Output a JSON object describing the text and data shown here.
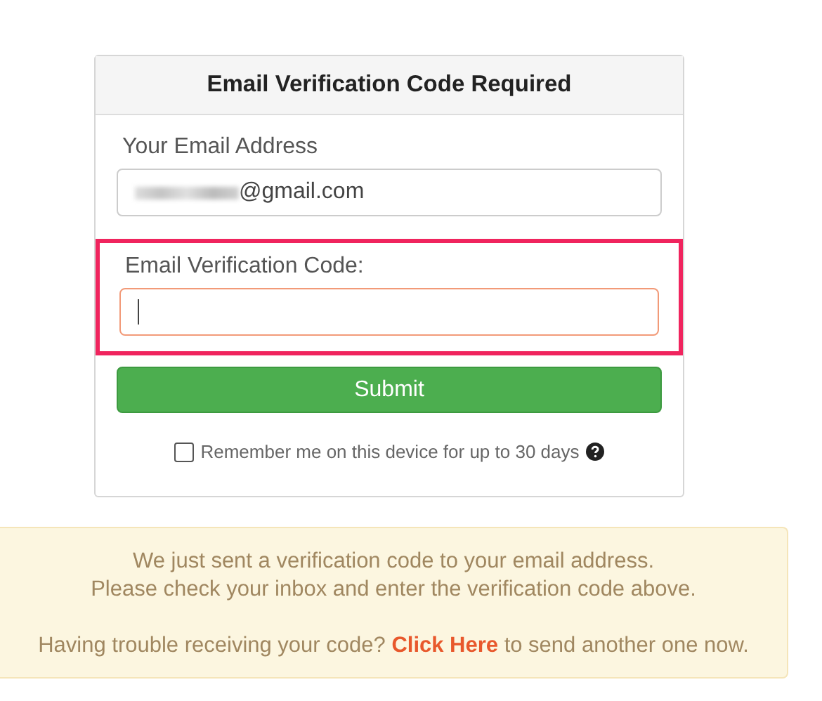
{
  "card": {
    "title": "Email Verification Code Required"
  },
  "email_field": {
    "label": "Your Email Address",
    "value": "@gmail.com",
    "blurred": true
  },
  "code_field": {
    "label": "Email Verification Code:",
    "focused": true,
    "highlighted": true
  },
  "submit_button": "Submit",
  "remember": {
    "label": "Remember me on this device for up to 30 days",
    "checked": false
  },
  "notice": {
    "lines": [
      "We just sent a verification code to your email address.",
      "Please check your inbox and enter the verification code above."
    ],
    "trouble_prefix": "Having trouble receiving your code?",
    "link": "Click Here",
    "trouble_suffix": "to send another one now."
  }
}
